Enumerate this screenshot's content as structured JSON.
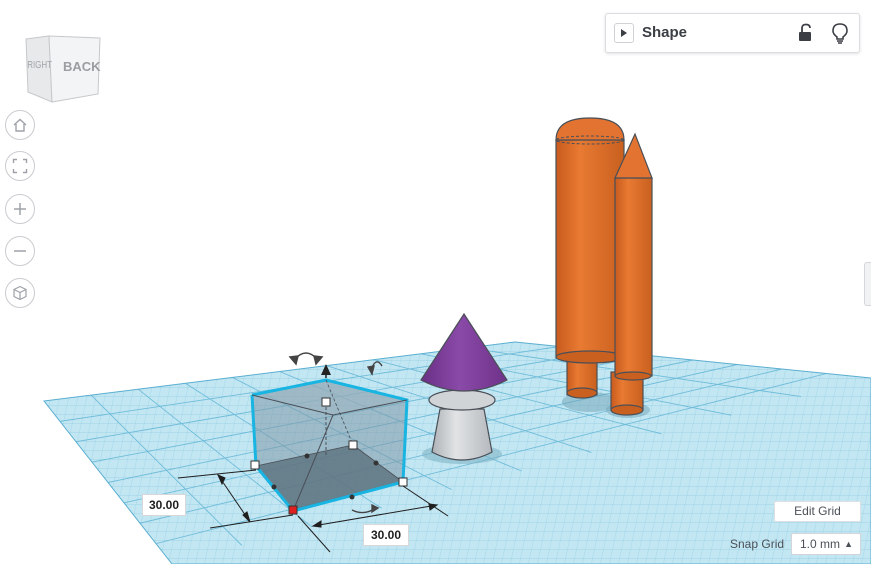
{
  "view_cube": {
    "right_face": "RIGHT",
    "back_face": "BACK"
  },
  "nav_buttons": [
    "home-icon",
    "fit-view-icon",
    "zoom-in-icon",
    "zoom-out-icon",
    "perspective-icon"
  ],
  "shape_panel": {
    "title": "Shape",
    "icons": [
      "lock-open-icon",
      "lightbulb-icon"
    ]
  },
  "dimensions": {
    "width": "30.00",
    "depth": "30.00"
  },
  "grid": {
    "edit_grid_label": "Edit Grid",
    "snap_grid_label": "Snap Grid",
    "snap_value": "1.0 mm"
  },
  "colors": {
    "grid_fill": "#bde3f0",
    "grid_line": "#7cc4de",
    "selection": "#15b3e0",
    "orange": "#e0702c",
    "purple": "#7b3f98",
    "gray": "#c8cbce"
  }
}
